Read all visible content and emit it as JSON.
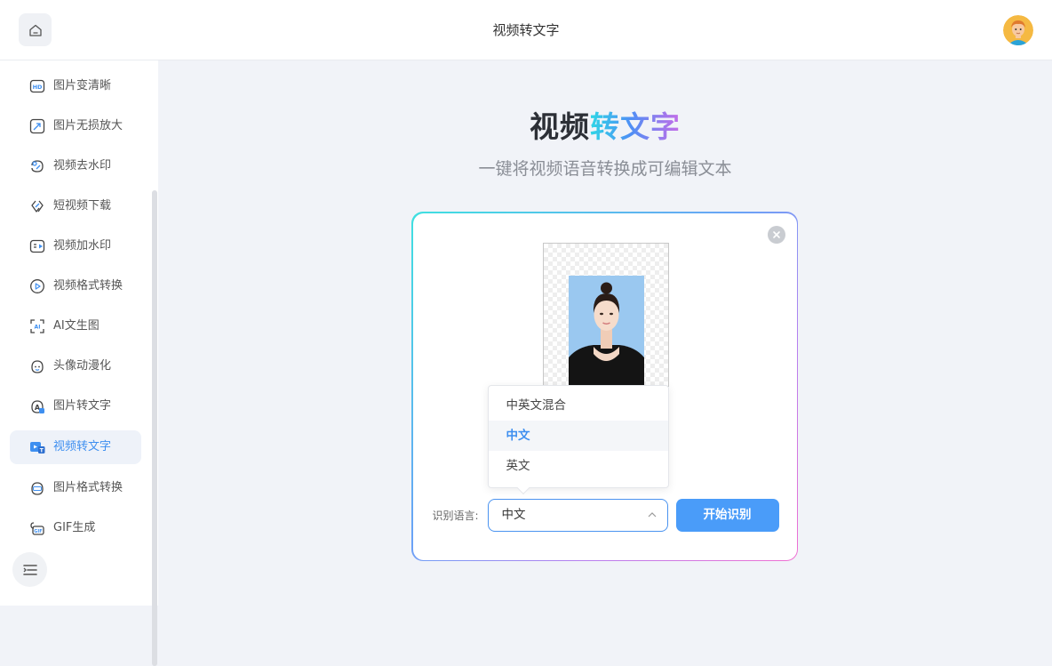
{
  "header": {
    "title": "视频转文字",
    "home_icon": "home-icon",
    "avatar_icon": "user-avatar"
  },
  "sidebar": {
    "items": [
      {
        "label": "图片变清晰",
        "icon": "hd-icon"
      },
      {
        "label": "图片无损放大",
        "icon": "enlarge-icon"
      },
      {
        "label": "视频去水印",
        "icon": "watermark-remove-icon"
      },
      {
        "label": "短视频下载",
        "icon": "download-link-icon"
      },
      {
        "label": "视频加水印",
        "icon": "add-watermark-icon"
      },
      {
        "label": "视频格式转换",
        "icon": "play-circle-icon"
      },
      {
        "label": "AI文生图",
        "icon": "ai-image-icon"
      },
      {
        "label": "头像动漫化",
        "icon": "cartoon-face-icon"
      },
      {
        "label": "图片转文字",
        "icon": "image-text-icon"
      },
      {
        "label": "视频转文字",
        "icon": "video-text-icon",
        "active": true
      },
      {
        "label": "图片格式转换",
        "icon": "image-format-icon"
      },
      {
        "label": "GIF生成",
        "icon": "gif-icon"
      }
    ],
    "collapse_icon": "collapse-menu-icon"
  },
  "hero": {
    "title_part1": "视频",
    "title_part2": "转文字",
    "subtitle": "一键将视频语音转换成可编辑文本"
  },
  "card": {
    "close_icon": "close-icon",
    "dropdown_options": [
      "中英文混合",
      "中文",
      "英文"
    ],
    "selected_option": "中文",
    "language_label": "识别语言:",
    "select_value": "中文",
    "start_button": "开始识别"
  },
  "colors": {
    "accent": "#4a9cf9",
    "active_text": "#3e8ff0",
    "page_bg": "#f1f3f8"
  }
}
